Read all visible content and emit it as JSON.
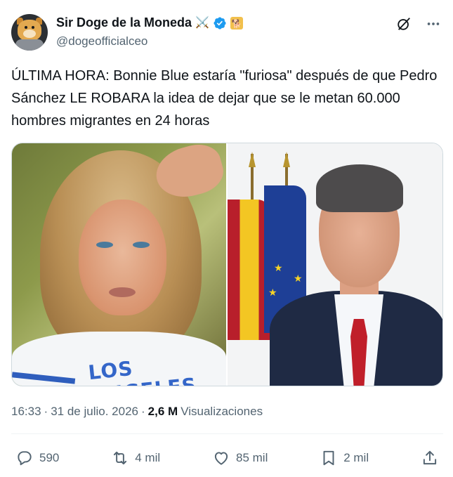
{
  "author": {
    "display_name": "Sir Doge de la Moneda",
    "swords_emoji": "⚔️",
    "doge_emoji": "🐕",
    "handle": "@dogeofficialceo",
    "verified_color": "#1d9bf0"
  },
  "tweet": {
    "text": "ÚLTIMA HORA: Bonnie Blue estaría \"furiosa\" después de que Pedro Sánchez LE ROBARA la idea de dejar que se le metan 60.000 hombres migrantes en 24 horas"
  },
  "left_photo": {
    "shirt_text": "LOS ANGELES"
  },
  "meta": {
    "time": "16:33",
    "separator": "·",
    "date": "31 de julio. 2026",
    "separator2": "·",
    "views_count": "2,6 M",
    "views_label": "Visualizaciones"
  },
  "actions": {
    "replies": "590",
    "reposts": "4 mil",
    "likes": "85 mil",
    "bookmarks": "2 mil"
  },
  "icons": {
    "grok": "grok-icon",
    "more": "more-icon",
    "reply": "reply-icon",
    "repost": "repost-icon",
    "like": "heart-icon",
    "bookmark": "bookmark-icon",
    "share": "share-icon"
  }
}
